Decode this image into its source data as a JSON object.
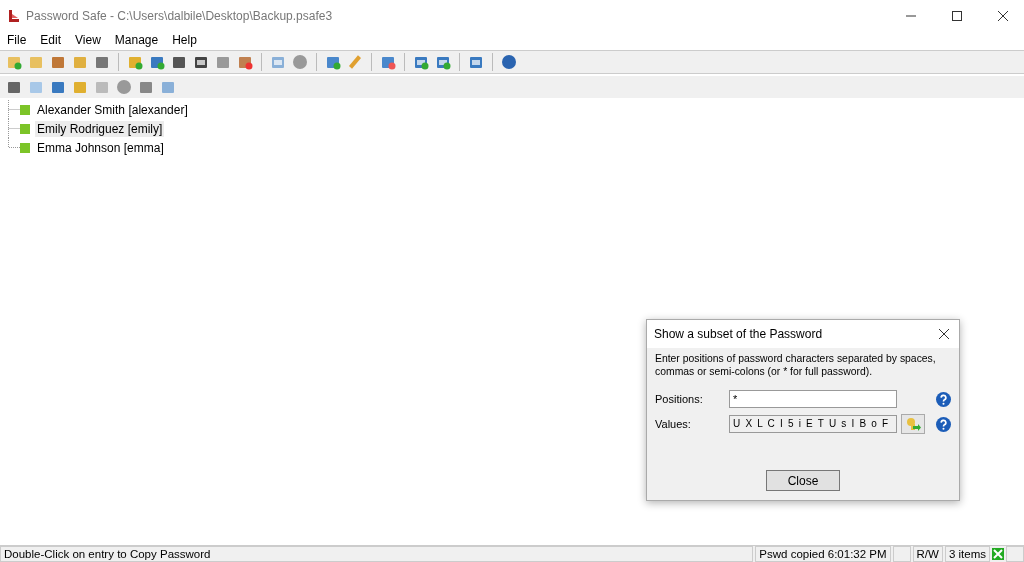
{
  "window": {
    "title": "Password Safe - C:\\Users\\dalbile\\Desktop\\Backup.psafe3"
  },
  "menu": [
    "File",
    "Edit",
    "View",
    "Manage",
    "Help"
  ],
  "tree": [
    {
      "label": "Alexander Smith [alexander]",
      "selected": false
    },
    {
      "label": "Emily Rodriguez [emily]",
      "selected": true
    },
    {
      "label": "Emma Johnson [emma]",
      "selected": false
    }
  ],
  "dialog": {
    "title": "Show a subset of the Password",
    "instructions": "Enter positions of password characters separated by spaces, commas or semi-colons (or * for full password).",
    "positions_label": "Positions:",
    "positions_value": "*",
    "values_label": "Values:",
    "values_value": "U X L C I 5 i E T U s I B o F",
    "close_button": "Close"
  },
  "status_bar": {
    "message": "Double-Click on entry to Copy Password",
    "copied": "Pswd copied 6:01:32 PM",
    "mode": "R/W",
    "count": "3 items"
  }
}
